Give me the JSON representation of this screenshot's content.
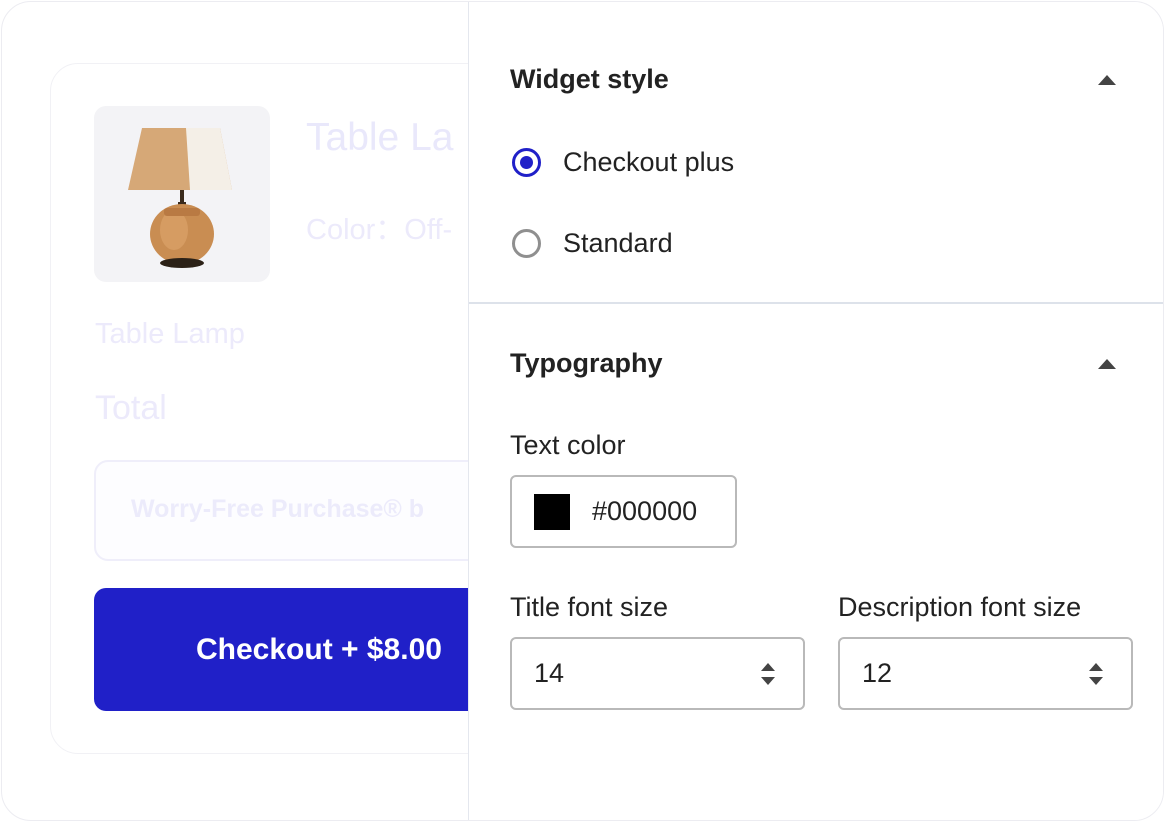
{
  "preview": {
    "product_title": "Table La",
    "product_color": "Color：Off-",
    "line_item": "Table Lamp",
    "total_label": "Total",
    "worry_free_text": "Worry-Free Purchase® b",
    "checkout_button": "Checkout + $8.00",
    "product_image_icon": "table-lamp-image",
    "accent_color": "#2020c8"
  },
  "settings": {
    "widget_style": {
      "title": "Widget style",
      "options": [
        {
          "label": "Checkout plus",
          "selected": true
        },
        {
          "label": "Standard",
          "selected": false
        }
      ]
    },
    "typography": {
      "title": "Typography",
      "text_color_label": "Text color",
      "text_color_value": "#000000",
      "title_font_size_label": "Title font size",
      "title_font_size_value": "14",
      "description_font_size_label": "Description font size",
      "description_font_size_value": "12"
    }
  }
}
